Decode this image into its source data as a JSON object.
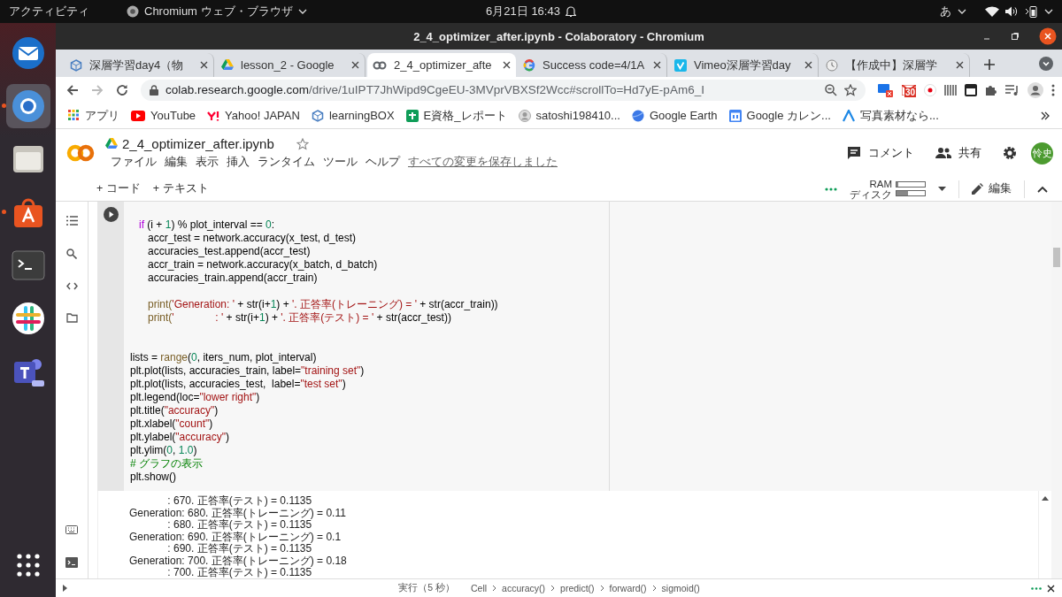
{
  "topbar": {
    "activities": "アクティビティ",
    "app_menu": "Chromium ウェブ・ブラウザ",
    "clock": "6月21日  16:43",
    "input_method": "あ"
  },
  "dock": {
    "items": [
      {
        "running": false,
        "selected": false
      },
      {
        "running": true,
        "selected": true
      },
      {
        "running": false,
        "selected": false
      },
      {
        "running": true,
        "selected": false
      },
      {
        "running": false,
        "selected": false
      },
      {
        "running": false,
        "selected": false
      },
      {
        "running": false,
        "selected": false
      },
      {
        "running": false,
        "selected": false
      }
    ]
  },
  "window": {
    "title": "2_4_optimizer_after.ipynb - Colaboratory - Chromium"
  },
  "tabs": [
    {
      "title": "深層学習day4（物",
      "selected": false
    },
    {
      "title": "lesson_2 - Google",
      "selected": false
    },
    {
      "title": "2_4_optimizer_afte",
      "selected": true
    },
    {
      "title": "Success code=4/1A",
      "selected": false
    },
    {
      "title": "Vimeo深層学習day",
      "selected": false
    },
    {
      "title": "【作成中】深層学",
      "selected": false
    }
  ],
  "address": {
    "host": "colab.research.google.com",
    "path": "/drive/1uIPT7JhWipd9CgeEU-3MVprVBXSf2Wcc#scrollTo=Hd7yE-pAm6_I",
    "mail_badge": "30"
  },
  "bookmarks": [
    {
      "label": "アプリ"
    },
    {
      "label": "YouTube"
    },
    {
      "label": "Yahoo! JAPAN"
    },
    {
      "label": "learningBOX"
    },
    {
      "label": "E資格_レポート"
    },
    {
      "label": "satoshi198410..."
    },
    {
      "label": "Google Earth"
    },
    {
      "label": "Google カレン..."
    },
    {
      "label": "写真素材なら..."
    }
  ],
  "notebook": {
    "filename": "2_4_optimizer_after.ipynb",
    "menu": [
      "ファイル",
      "編集",
      "表示",
      "挿入",
      "ランタイム",
      "ツール",
      "ヘルプ"
    ],
    "save_status": "すべての変更を保存しました",
    "comment": "コメント",
    "share": "共有",
    "avatar": "怜史"
  },
  "toolbar": {
    "add_code": "+ コード",
    "add_text": "+ テキスト",
    "ram_label": "RAM",
    "ram": {
      "level": 0.05
    },
    "disk_label": "ディスク",
    "disk": {
      "level": 0.4
    },
    "edit": "編集"
  },
  "cell": {
    "lines": [
      {
        "kind": "code",
        "tokens": [
          {
            "kind": "keyword",
            "text": "   if"
          },
          {
            "kind": "plain",
            "text": " (i + "
          },
          {
            "kind": "number",
            "text": "1"
          },
          {
            "kind": "plain",
            "text": ") % plot_interval == "
          },
          {
            "kind": "number",
            "text": "0"
          },
          {
            "kind": "plain",
            "text": ":"
          }
        ]
      },
      {
        "kind": "code",
        "tokens": [
          {
            "kind": "plain",
            "text": "      accr_test = network.accuracy(x_test, d_test)"
          }
        ]
      },
      {
        "kind": "code",
        "tokens": [
          {
            "kind": "plain",
            "text": "      accuracies_test.append(accr_test)"
          }
        ]
      },
      {
        "kind": "code",
        "tokens": [
          {
            "kind": "plain",
            "text": "      accr_train = network.accuracy(x_batch, d_batch)"
          }
        ]
      },
      {
        "kind": "code",
        "tokens": [
          {
            "kind": "plain",
            "text": "      accuracies_train.append(accr_train)"
          }
        ]
      },
      {
        "kind": "blank"
      },
      {
        "kind": "code",
        "tokens": [
          {
            "kind": "builtin",
            "text": "      print("
          },
          {
            "kind": "string",
            "text": "'Generation: '"
          },
          {
            "kind": "plain",
            "text": " + str(i+"
          },
          {
            "kind": "number",
            "text": "1"
          },
          {
            "kind": "plain",
            "text": ") + "
          },
          {
            "kind": "string",
            "text": "'. 正答率(トレーニング) = '"
          },
          {
            "kind": "plain",
            "text": " + str(accr_train))"
          }
        ]
      },
      {
        "kind": "code",
        "tokens": [
          {
            "kind": "builtin",
            "text": "      print("
          },
          {
            "kind": "string",
            "text": "'              : '"
          },
          {
            "kind": "plain",
            "text": " + str(i+"
          },
          {
            "kind": "number",
            "text": "1"
          },
          {
            "kind": "plain",
            "text": ") + "
          },
          {
            "kind": "string",
            "text": "'. 正答率(テスト) = '"
          },
          {
            "kind": "plain",
            "text": " + str(accr_test))"
          }
        ]
      },
      {
        "kind": "blank"
      },
      {
        "kind": "blank"
      },
      {
        "kind": "code",
        "tokens": [
          {
            "kind": "plain",
            "text": "lists = "
          },
          {
            "kind": "builtin",
            "text": "range"
          },
          {
            "kind": "plain",
            "text": "("
          },
          {
            "kind": "number",
            "text": "0"
          },
          {
            "kind": "plain",
            "text": ", iters_num, plot_interval)"
          }
        ]
      },
      {
        "kind": "code",
        "tokens": [
          {
            "kind": "plain",
            "text": "plt.plot(lists, accuracies_train, label="
          },
          {
            "kind": "string",
            "text": "\"training set\""
          },
          {
            "kind": "plain",
            "text": ")"
          }
        ]
      },
      {
        "kind": "code",
        "tokens": [
          {
            "kind": "plain",
            "text": "plt.plot(lists, accuracies_test,  label="
          },
          {
            "kind": "string",
            "text": "\"test set\""
          },
          {
            "kind": "plain",
            "text": ")"
          }
        ]
      },
      {
        "kind": "code",
        "tokens": [
          {
            "kind": "plain",
            "text": "plt.legend(loc="
          },
          {
            "kind": "string",
            "text": "\"lower right\""
          },
          {
            "kind": "plain",
            "text": ")"
          }
        ]
      },
      {
        "kind": "code",
        "tokens": [
          {
            "kind": "plain",
            "text": "plt.title("
          },
          {
            "kind": "string",
            "text": "\"accuracy\""
          },
          {
            "kind": "plain",
            "text": ")"
          }
        ]
      },
      {
        "kind": "code",
        "tokens": [
          {
            "kind": "plain",
            "text": "plt.xlabel("
          },
          {
            "kind": "string",
            "text": "\"count\""
          },
          {
            "kind": "plain",
            "text": ")"
          }
        ]
      },
      {
        "kind": "code",
        "tokens": [
          {
            "kind": "plain",
            "text": "plt.ylabel("
          },
          {
            "kind": "string",
            "text": "\"accuracy\""
          },
          {
            "kind": "plain",
            "text": ")"
          }
        ]
      },
      {
        "kind": "code",
        "tokens": [
          {
            "kind": "plain",
            "text": "plt.ylim("
          },
          {
            "kind": "number",
            "text": "0"
          },
          {
            "kind": "plain",
            "text": ", "
          },
          {
            "kind": "number",
            "text": "1.0"
          },
          {
            "kind": "plain",
            "text": ")"
          }
        ]
      },
      {
        "kind": "code",
        "tokens": [
          {
            "kind": "comment",
            "text": "# グラフの表示"
          }
        ]
      },
      {
        "kind": "code",
        "tokens": [
          {
            "kind": "plain",
            "text": "plt.show()"
          }
        ]
      }
    ]
  },
  "output": {
    "lines": [
      "             : 670. 正答率(テスト) = 0.1135",
      "Generation: 680. 正答率(トレーニング) = 0.11",
      "             : 680. 正答率(テスト) = 0.1135",
      "Generation: 690. 正答率(トレーニング) = 0.1",
      "             : 690. 正答率(テスト) = 0.1135",
      "Generation: 700. 正答率(トレーニング) = 0.18",
      "             : 700. 正答率(テスト) = 0.1135"
    ]
  },
  "status_bar": {
    "run_time": "実行（5 秒）",
    "breadcrumb": [
      "Cell",
      "accuracy()",
      "predict()",
      "forward()",
      "sigmoid()"
    ]
  }
}
